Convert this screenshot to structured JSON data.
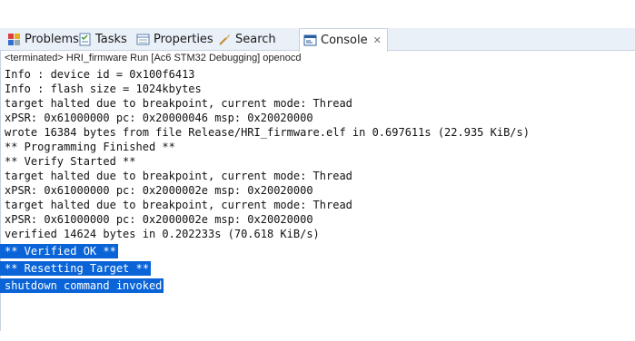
{
  "tabs": [
    {
      "label": "Problems",
      "icon": "problems-icon"
    },
    {
      "label": "Tasks",
      "icon": "tasks-icon"
    },
    {
      "label": "Properties",
      "icon": "properties-icon"
    },
    {
      "label": "Search",
      "icon": "search-icon"
    },
    {
      "label": "Console",
      "icon": "console-icon",
      "active": true
    }
  ],
  "status_line": "<terminated> HRI_firmware Run [Ac6 STM32 Debugging] openocd",
  "console_lines": [
    "Info : device id = 0x100f6413",
    "Info : flash size = 1024kbytes",
    "target halted due to breakpoint, current mode: Thread",
    "xPSR: 0x61000000 pc: 0x20000046 msp: 0x20020000",
    "wrote 16384 bytes from file Release/HRI_firmware.elf in 0.697611s (22.935 KiB/s)",
    "** Programming Finished **",
    "** Verify Started **",
    "target halted due to breakpoint, current mode: Thread",
    "xPSR: 0x61000000 pc: 0x2000002e msp: 0x20020000",
    "target halted due to breakpoint, current mode: Thread",
    "xPSR: 0x61000000 pc: 0x2000002e msp: 0x20020000",
    "verified 14624 bytes in 0.202233s (70.618 KiB/s)"
  ],
  "selected_lines": [
    "** Verified OK **",
    "** Resetting Target **",
    "shutdown command invoked"
  ],
  "colors": {
    "selection": "#0a64d7",
    "tab_bar": "#eaf0f8"
  }
}
